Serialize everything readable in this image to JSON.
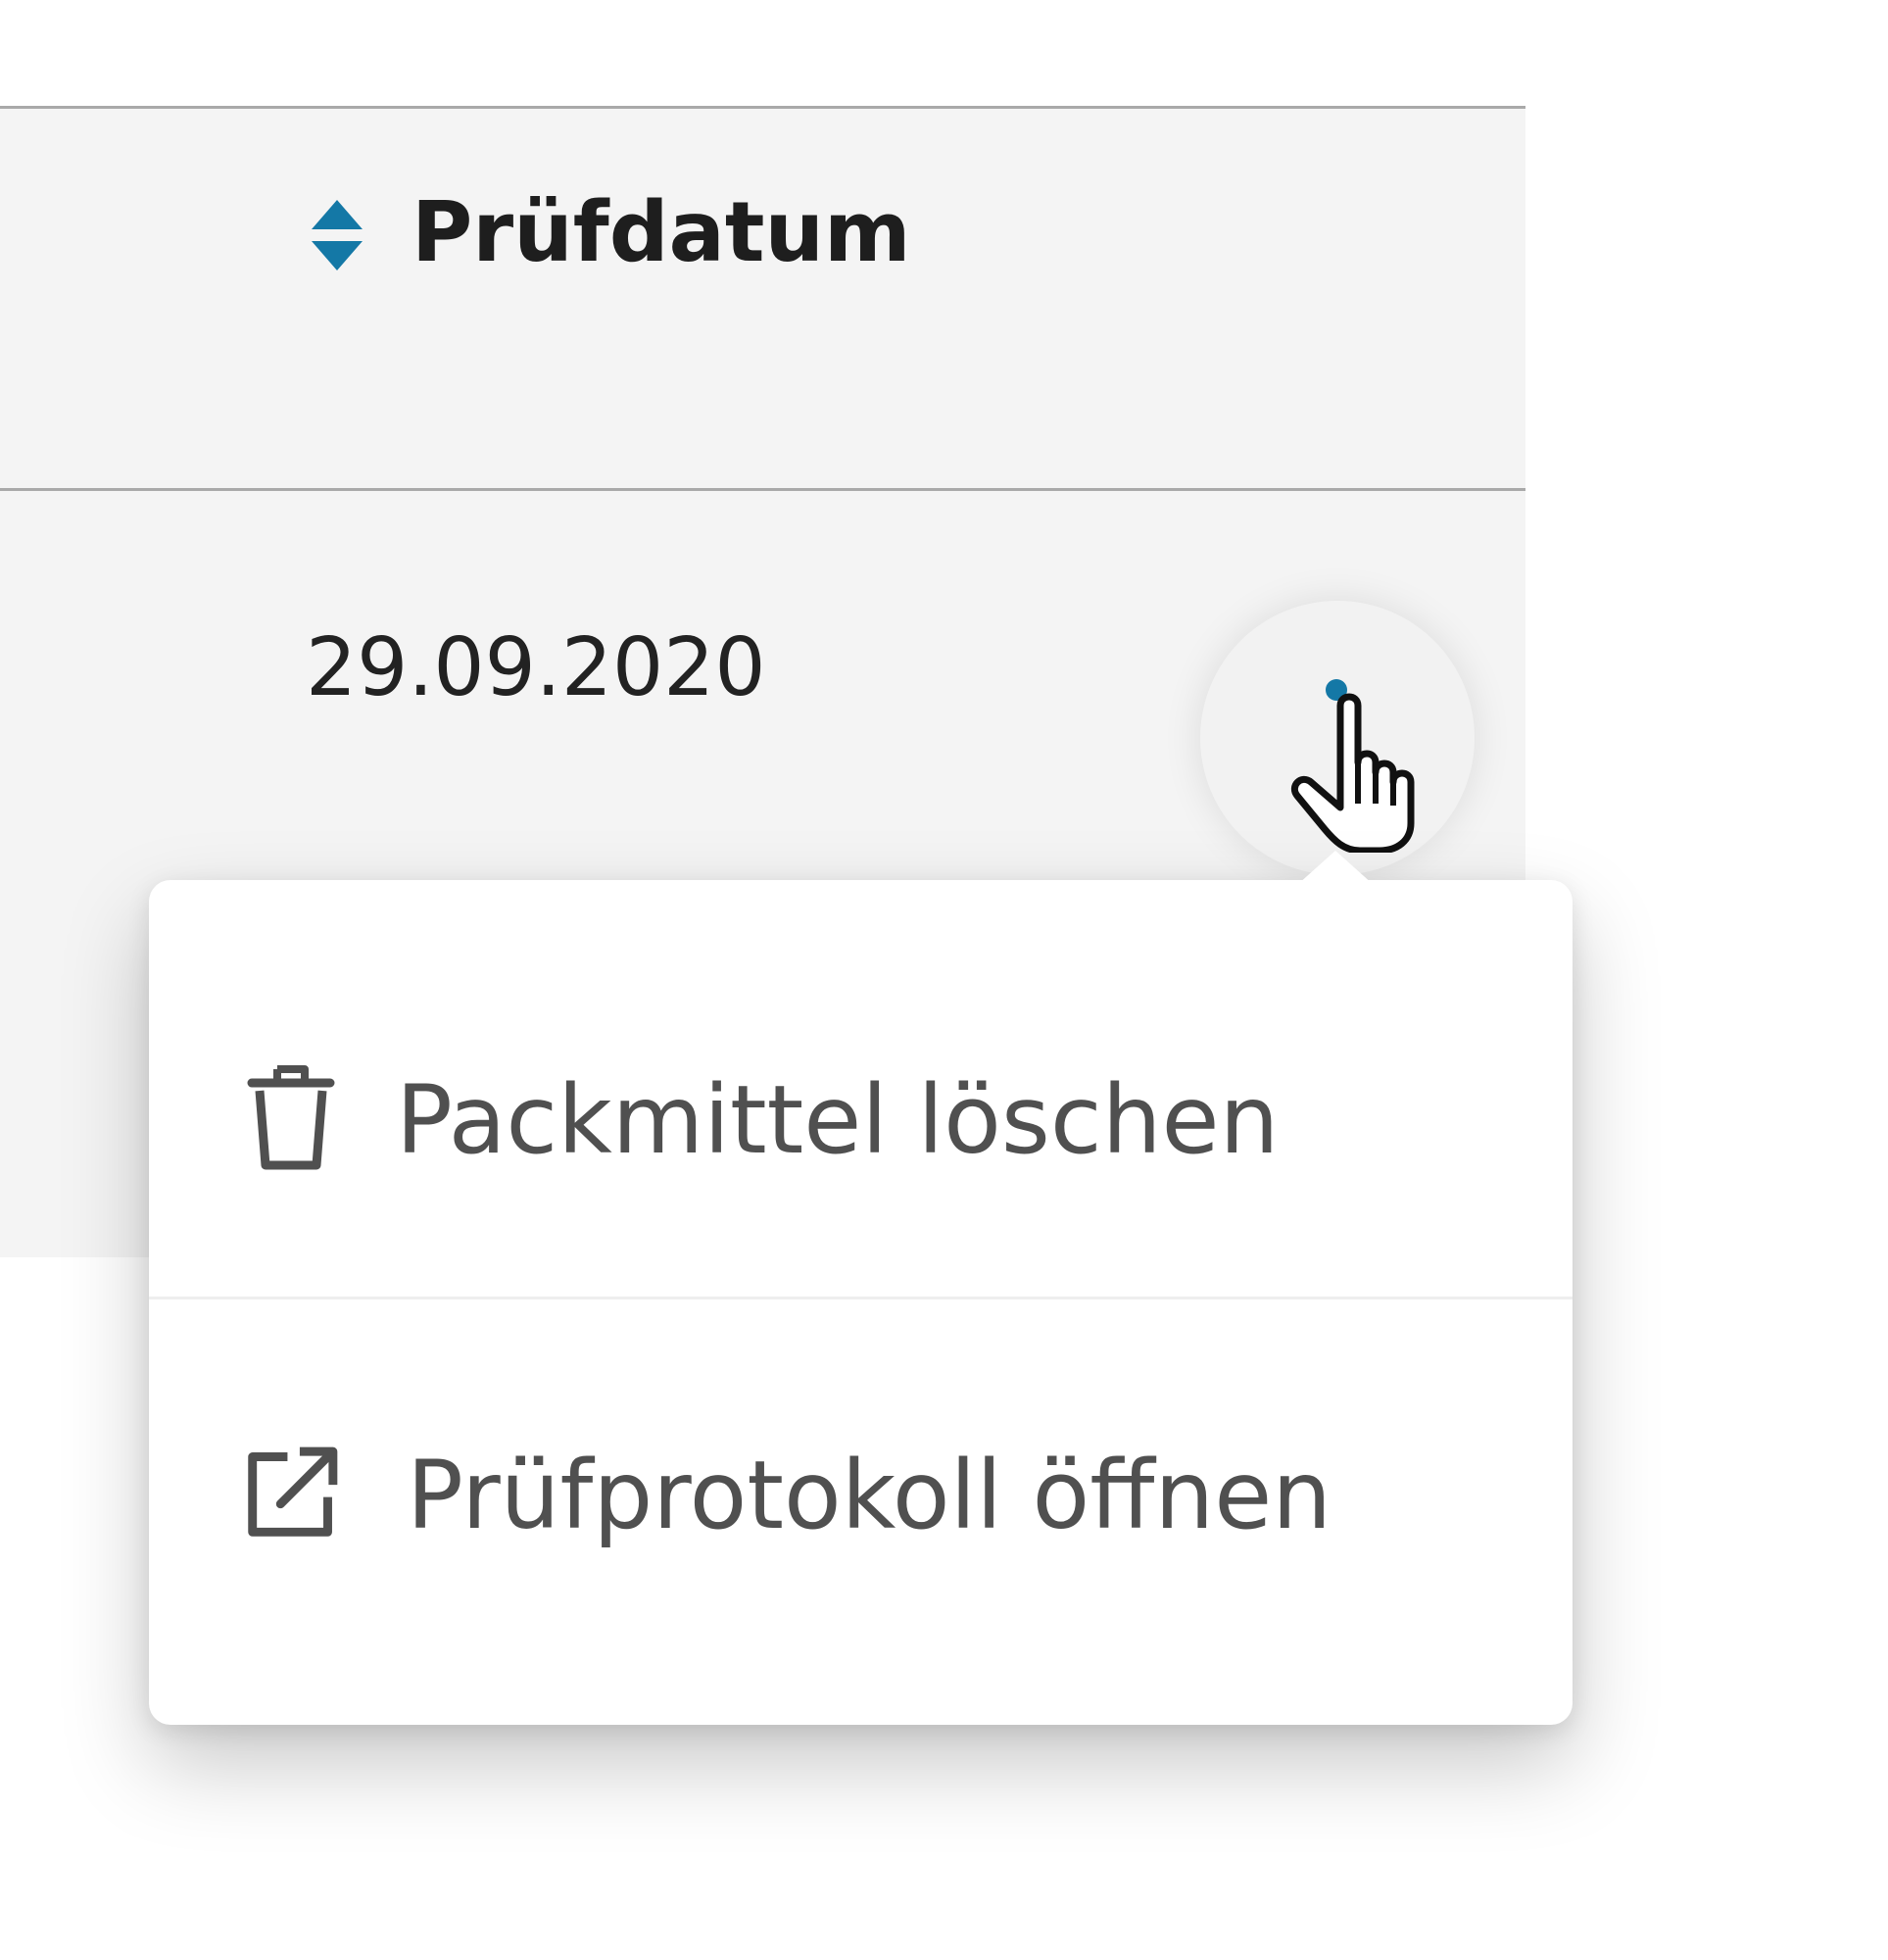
{
  "table": {
    "columns": [
      {
        "label": "Prüfdatum",
        "sort_icon": "sort-icon"
      }
    ],
    "rows": [
      {
        "pruefdatum": "29.09.2020",
        "action_icon": "more-vertical-icon"
      }
    ]
  },
  "context_menu": {
    "items": [
      {
        "label": "Packmittel löschen",
        "icon": "trash-icon"
      },
      {
        "label": "Prüfprotokoll öffnen",
        "icon": "external-link-icon"
      }
    ]
  },
  "colors": {
    "accent": "#1478a6",
    "header_bg": "#f4f4f4",
    "menu_text": "#505050",
    "heading_text": "#1e1e1e"
  }
}
